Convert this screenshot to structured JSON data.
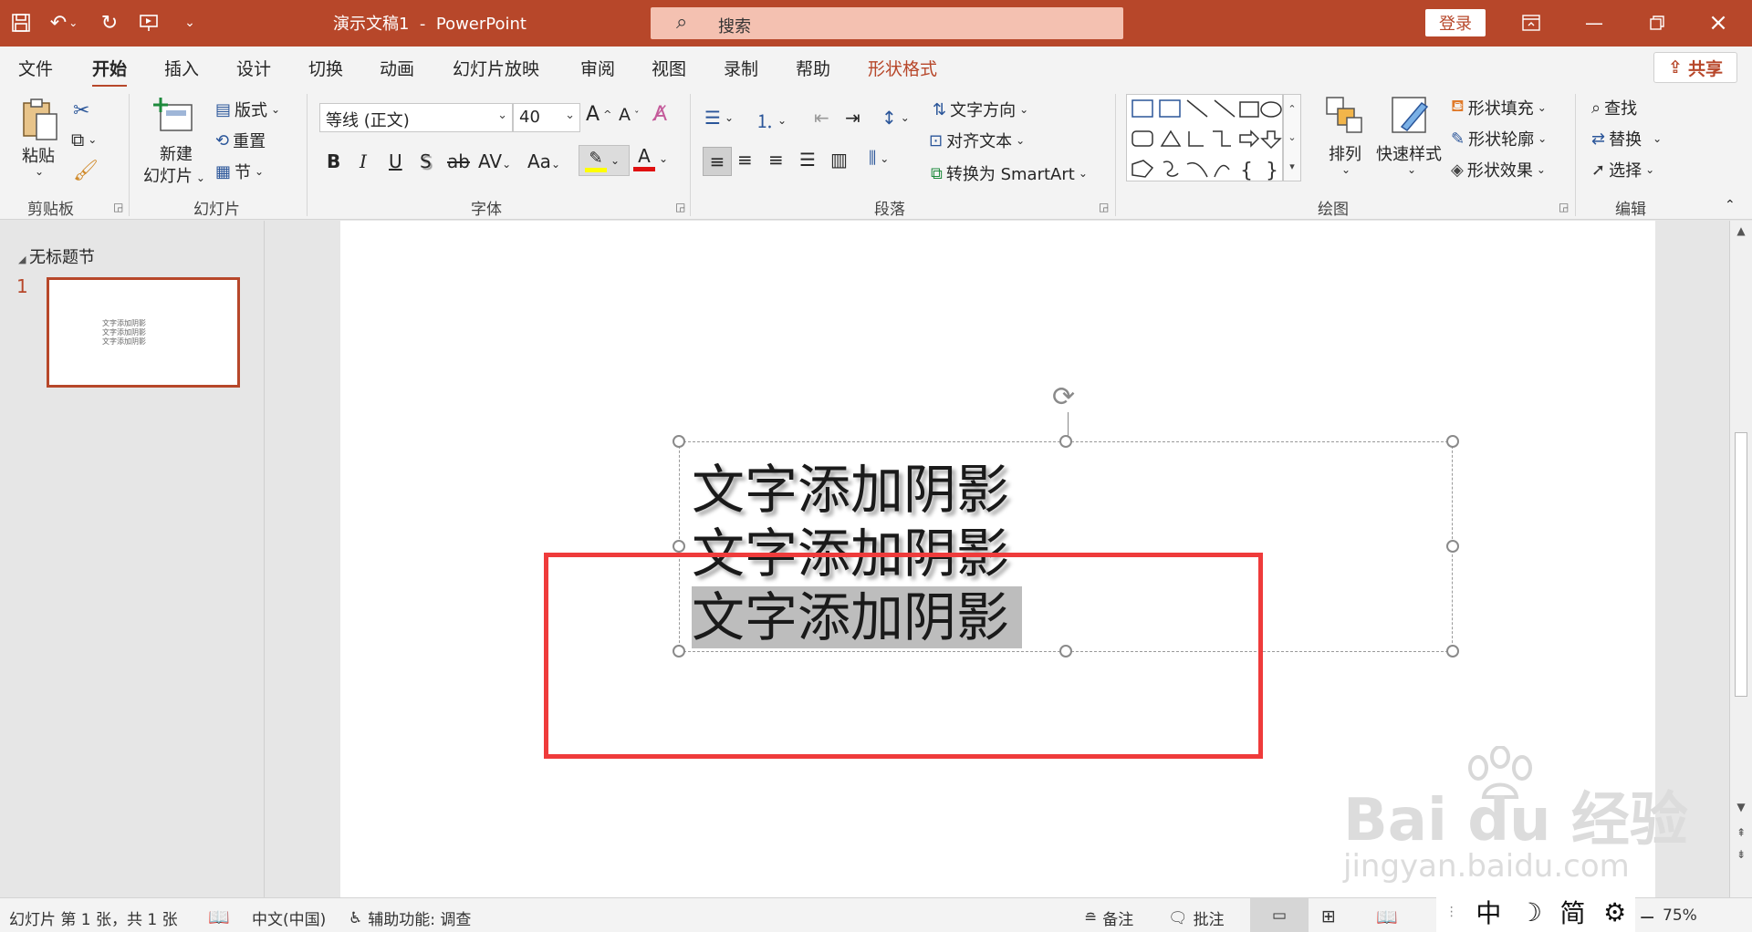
{
  "window": {
    "doc_name": "演示文稿1",
    "separator": "-",
    "app_name": "PowerPoint",
    "search_placeholder": "搜索",
    "login_label": "登录"
  },
  "tabs": {
    "file": "文件",
    "home": "开始",
    "insert": "插入",
    "design": "设计",
    "transitions": "切换",
    "animations": "动画",
    "slideshow": "幻灯片放映",
    "review": "审阅",
    "view": "视图",
    "record": "录制",
    "help": "帮助",
    "shape_format": "形状格式",
    "share": "共享"
  },
  "ribbon": {
    "clipboard": {
      "paste": "粘贴",
      "label": "剪贴板"
    },
    "slides": {
      "new_line1": "新建",
      "new_line2": "幻灯片",
      "layout": "版式",
      "reset": "重置",
      "section": "节",
      "label": "幻灯片"
    },
    "font": {
      "name": "等线 (正文)",
      "size": "40",
      "bold": "B",
      "italic": "I",
      "underline": "U",
      "shadow": "S",
      "strike": "ab",
      "spacing": "AV",
      "case": "Aa",
      "font_color_glyph": "A",
      "grow_glyph": "A",
      "shrink_glyph": "A",
      "label": "字体"
    },
    "paragraph": {
      "text_direction": "文字方向",
      "align_text": "对齐文本",
      "smartart": "转换为 SmartArt",
      "label": "段落"
    },
    "drawing": {
      "arrange": "排列",
      "quick_styles": "快速样式",
      "fill": "形状填充",
      "outline": "形状轮廓",
      "effects": "形状效果",
      "label": "绘图"
    },
    "editing": {
      "find": "查找",
      "replace": "替换",
      "select": "选择",
      "label": "编辑"
    }
  },
  "thumbnails": {
    "section": "无标题节",
    "slide_number": "1",
    "thumb_lines": [
      "文字添加阴影",
      "文字添加阴影",
      "文字添加阴影"
    ]
  },
  "slide": {
    "lines": [
      "文字添加阴影",
      "文字添加阴影",
      "文字添加阴影"
    ]
  },
  "watermark": {
    "main": "Bai du 经验",
    "sub": "jingyan.baidu.com"
  },
  "status": {
    "slide_info": "幻灯片 第 1 张，共 1 张",
    "language": "中文(中国)",
    "accessibility": "辅助功能: 调查",
    "notes": "备注",
    "comments": "批注",
    "zoom": "75%",
    "zoom_minus": "−"
  },
  "ime": {
    "mode": "中",
    "moon": "☽",
    "simplified": "简",
    "settings": "⚙"
  },
  "colors": {
    "accent": "#b7472a",
    "highlight_box": "#ef3b3b",
    "selection": "#bdbdbd"
  }
}
